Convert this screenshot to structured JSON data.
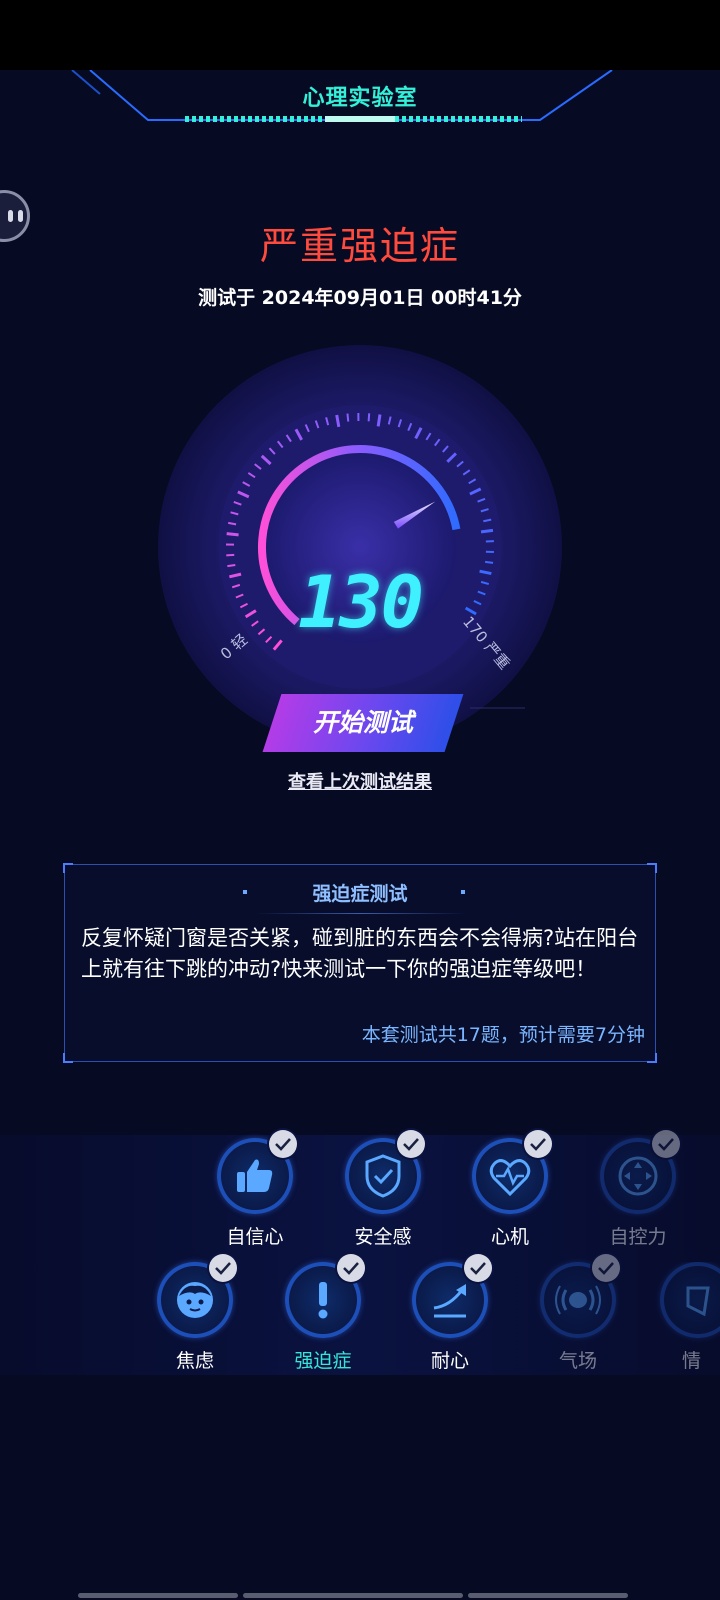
{
  "header": {
    "title": "心理实验室"
  },
  "result": {
    "title": "严重强迫症",
    "date": "测试于 2024年09月01日 00时41分"
  },
  "gauge": {
    "score": "130",
    "min_label": "0 轻",
    "max_label": "170 严重",
    "value": 130,
    "min": 0,
    "max": 170
  },
  "actions": {
    "start_button": "开始测试",
    "last_result_link": "查看上次测试结果"
  },
  "info_card": {
    "title": "强迫症测试",
    "description": "反复怀疑门窗是否关紧，碰到脏的东西会不会得病?站在阳台上就有往下跳的冲动?快来测试一下你的强迫症等级吧！",
    "meta": "本套测试共17题，预计需要7分钟"
  },
  "categories": {
    "row1": [
      {
        "label": "自信心",
        "icon": "thumbs-up-icon",
        "checked": true
      },
      {
        "label": "安全感",
        "icon": "shield-icon",
        "checked": true
      },
      {
        "label": "心机",
        "icon": "heart-pulse-icon",
        "checked": true
      },
      {
        "label": "自控力",
        "icon": "joystick-icon",
        "checked": true
      }
    ],
    "row2": [
      {
        "label": "焦虑",
        "icon": "face-icon",
        "checked": true
      },
      {
        "label": "强迫症",
        "icon": "exclamation-icon",
        "checked": true,
        "active": true
      },
      {
        "label": "耐心",
        "icon": "trend-arrow-icon",
        "checked": true
      },
      {
        "label": "气场",
        "icon": "aura-icon",
        "checked": true
      },
      {
        "label": "情",
        "icon": "partial-icon",
        "checked": false
      }
    ]
  },
  "colors": {
    "accent": "#34f0d8",
    "result_red": "#ff4a3e",
    "score_cyan": "#3ff1ff",
    "link_blue": "#7ab6ff"
  }
}
